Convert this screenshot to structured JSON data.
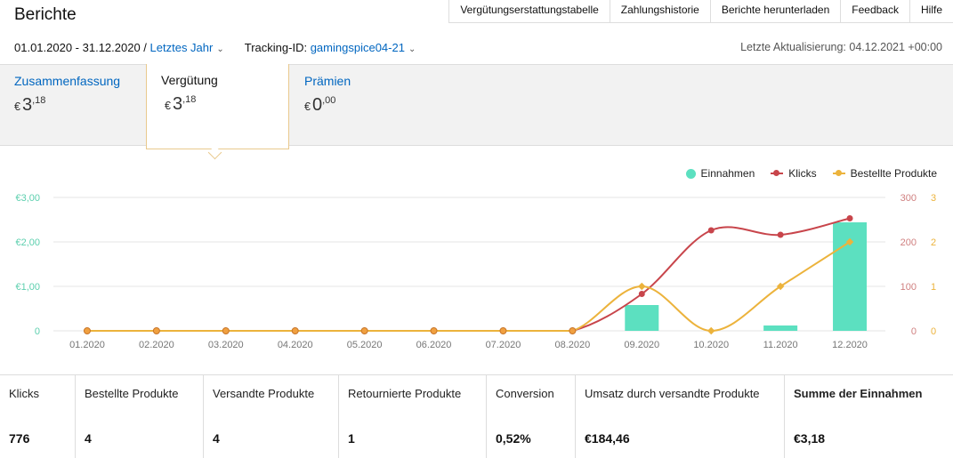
{
  "header": {
    "title": "Berichte"
  },
  "topnav": [
    "Vergütungserstattungstabelle",
    "Zahlungshistorie",
    "Berichte herunterladen",
    "Feedback",
    "Hilfe"
  ],
  "filters": {
    "date_range": "01.01.2020 - 31.12.2020 /",
    "period": "Letztes Jahr",
    "tracking_label": "Tracking-ID:",
    "tracking_id": "gamingspice04-21",
    "last_update": "Letzte Aktualisierung: 04.12.2021 +00:00"
  },
  "tabs": [
    {
      "label": "Zusammenfassung",
      "currency": "€",
      "whole": "3",
      "decimal": ",18"
    },
    {
      "label": "Vergütung",
      "currency": "€",
      "whole": "3",
      "decimal": ",18"
    },
    {
      "label": "Prämien",
      "currency": "€",
      "whole": "0",
      "decimal": ",00"
    }
  ],
  "legend": {
    "earnings": "Einnahmen",
    "clicks": "Klicks",
    "ordered": "Bestellte Produkte"
  },
  "colors": {
    "earnings": "#5ce0c0",
    "clicks": "#c8454b",
    "ordered": "#ecb33c",
    "link": "#0066c0",
    "tab_border": "#e9c98d"
  },
  "chart_data": {
    "type": "bar+line",
    "categories": [
      "01.2020",
      "02.2020",
      "03.2020",
      "04.2020",
      "05.2020",
      "06.2020",
      "07.2020",
      "08.2020",
      "09.2020",
      "10.2020",
      "11.2020",
      "12.2020"
    ],
    "series": [
      {
        "name": "Einnahmen",
        "type": "bar",
        "axis": "left",
        "values": [
          0,
          0,
          0,
          0,
          0,
          0,
          0,
          0,
          0.58,
          0,
          0.12,
          2.44
        ]
      },
      {
        "name": "Klicks",
        "type": "line",
        "axis": "right1",
        "values": [
          0,
          0,
          0,
          0,
          0,
          0,
          0,
          0,
          83,
          226,
          216,
          253
        ]
      },
      {
        "name": "Bestellte Produkte",
        "type": "line",
        "axis": "right2",
        "values": [
          0,
          0,
          0,
          0,
          0,
          0,
          0,
          0,
          1,
          0,
          1,
          2
        ]
      }
    ],
    "y_left": {
      "ticks": [
        "0",
        "€1,00",
        "€2,00",
        "€3,00"
      ],
      "range": [
        0,
        3
      ]
    },
    "y_right1": {
      "ticks": [
        "0",
        "100",
        "200",
        "300"
      ],
      "range": [
        0,
        300
      ]
    },
    "y_right2": {
      "ticks": [
        "0",
        "1",
        "2",
        "3"
      ],
      "range": [
        0,
        3
      ]
    },
    "grid": true,
    "legend_position": "top-right"
  },
  "stats": [
    {
      "label": "Klicks",
      "value": "776"
    },
    {
      "label": "Bestellte Produkte",
      "value": "4"
    },
    {
      "label": "Versandte Produkte",
      "value": "4"
    },
    {
      "label": "Retournierte Produkte",
      "value": "1"
    },
    {
      "label": "Conversion",
      "value": "0,52%"
    },
    {
      "label": "Umsatz durch versandte Produkte",
      "value": "€184,46"
    },
    {
      "label": "Summe der Einnahmen",
      "value": "€3,18"
    }
  ]
}
